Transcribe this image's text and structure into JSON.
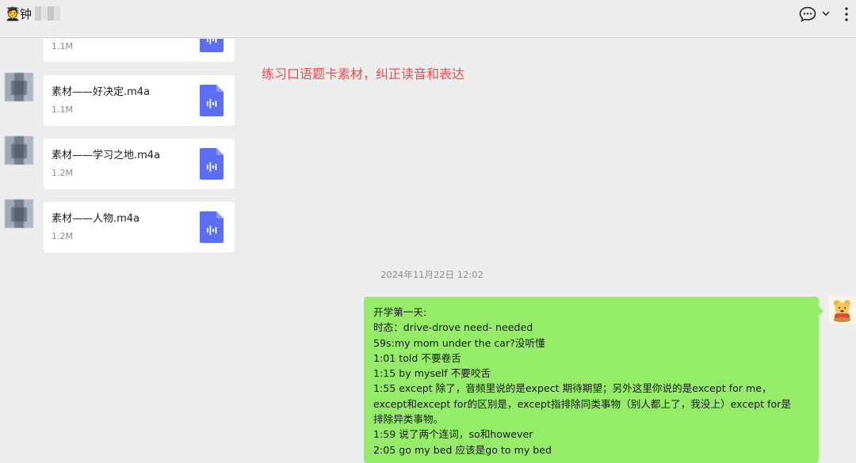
{
  "header": {
    "avatar_emoji": "🧑‍🎓",
    "title": "钟",
    "chat_icon": "chat-bubble-icon",
    "chevron_icon": "chevron-down-icon",
    "more_icon": "more-vertical-icon"
  },
  "files": [
    {
      "name": "",
      "size": "1.1M"
    },
    {
      "name": "素材——好决定.m4a",
      "size": "1.1M"
    },
    {
      "name": "素材——学习之地.m4a",
      "size": "1.2M"
    },
    {
      "name": "素材——人物.m4a",
      "size": "1.2M"
    }
  ],
  "note": "练习口语题卡素材，纠正读音和表达",
  "timestamp": "2024年11月22日 12:02",
  "message": {
    "lines": [
      "开学第一天:",
      "时态：drive-drove need- needed",
      "59s:my mom under the car?没听懂",
      "1:01 told 不要卷舌",
      "1:15 by myself 不要咬舌",
      "1:55 except 除了，音频里说的是expect 期待期望；另外这里你说的是except for me，",
      "except和except for的区别是，except指排除同类事物（别人都上了，我没上）except for是",
      "排除异类事物。",
      "1:59 说了两个连词，so和however",
      "2:05 go my bed 应该是go to my bed"
    ]
  },
  "colors": {
    "background": "#ededed",
    "bubble": "#95ec69",
    "note": "#f24a4a",
    "file_icon": "#5b6ef5"
  }
}
